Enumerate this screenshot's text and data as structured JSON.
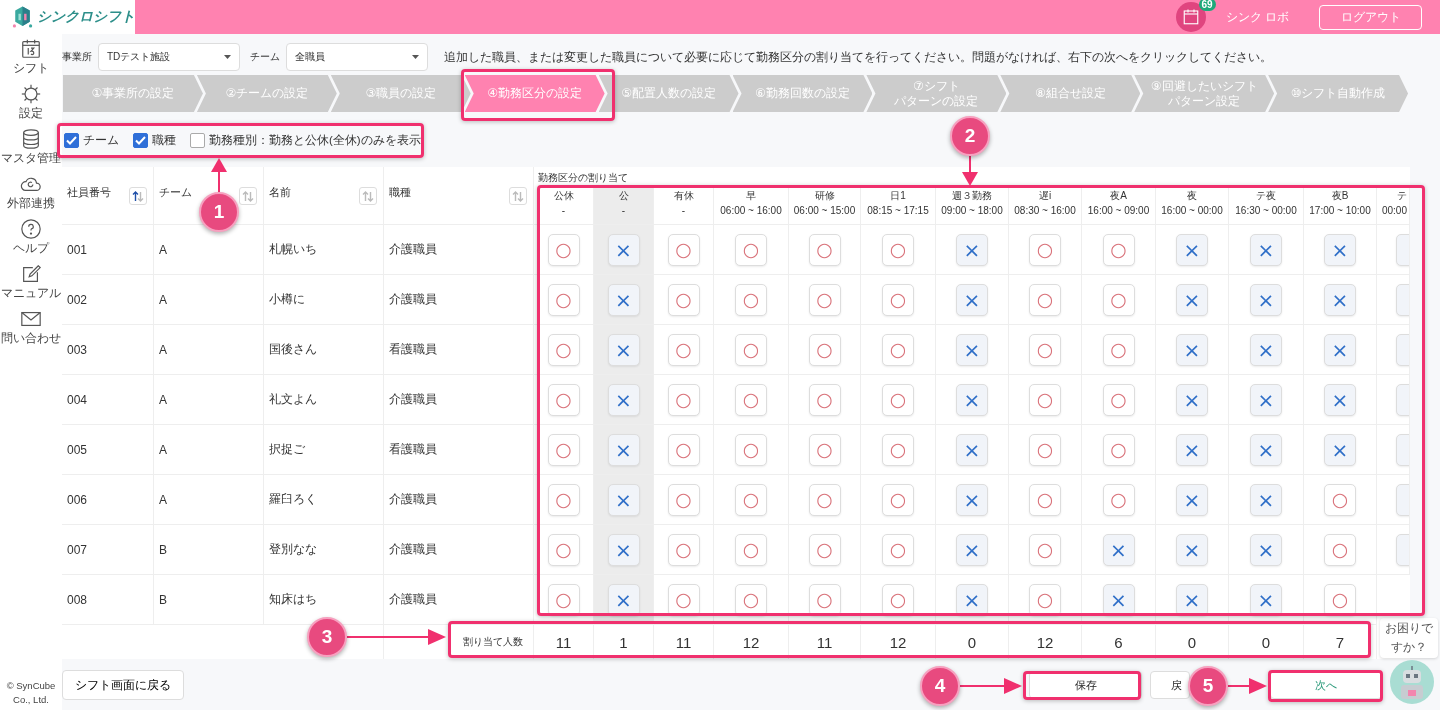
{
  "header": {
    "app_name": "シンクロシフト",
    "notification_count": "69",
    "user_name": "シンク ロボ",
    "logout_label": "ログアウト"
  },
  "sidebar": {
    "items": [
      {
        "label": "シフト",
        "kind": "calendar"
      },
      {
        "label": "設定",
        "kind": "gear"
      },
      {
        "label": "マスタ管理",
        "kind": "database"
      },
      {
        "label": "外部連携",
        "kind": "cloud"
      },
      {
        "label": "ヘルプ",
        "kind": "help"
      },
      {
        "label": "マニュアル",
        "kind": "edit"
      },
      {
        "label": "問い合わせ",
        "kind": "mail"
      }
    ],
    "copyright": [
      "© SynCube",
      "Co., Ltd."
    ]
  },
  "filters": {
    "office_label": "事業所",
    "office_value": "TDテスト施設",
    "team_label": "チーム",
    "team_value": "全職員",
    "instruction": "追加した職員、または変更した職員について必要に応じて勤務区分の割り当てを行ってください。問題がなければ、右下の次へをクリックしてください。"
  },
  "steps": [
    {
      "lines": [
        "①事業所の設定"
      ],
      "selected": false
    },
    {
      "lines": [
        "②チームの設定"
      ],
      "selected": false
    },
    {
      "lines": [
        "③職員の設定"
      ],
      "selected": false
    },
    {
      "lines": [
        "④勤務区分の設定"
      ],
      "selected": true
    },
    {
      "lines": [
        "⑤配置人数の設定"
      ],
      "selected": false
    },
    {
      "lines": [
        "⑥勤務回数の設定"
      ],
      "selected": false
    },
    {
      "lines": [
        "⑦シフト",
        "パターンの設定"
      ],
      "selected": false
    },
    {
      "lines": [
        "⑧組合せ設定"
      ],
      "selected": false
    },
    {
      "lines": [
        "⑨回避したいシフト",
        "パターン設定"
      ],
      "selected": false
    },
    {
      "lines": [
        "⑩シフト自動作成"
      ],
      "selected": false
    }
  ],
  "display_options": [
    {
      "label": "チーム",
      "checked": true
    },
    {
      "label": "職種",
      "checked": true
    },
    {
      "label": "勤務種別：勤務と公休(全休)のみを表示",
      "checked": false
    }
  ],
  "table": {
    "columns": [
      {
        "label": "社員番号",
        "sorted": true
      },
      {
        "label": "チーム",
        "sorted": false
      },
      {
        "label": "名前",
        "sorted": false
      },
      {
        "label": "職種",
        "sorted": false
      }
    ],
    "assignment_title": "勤務区分の割り当て",
    "shift_columns": [
      {
        "label": "公休",
        "time": "-",
        "highlighted": false
      },
      {
        "label": "公",
        "time": "-",
        "highlighted": true
      },
      {
        "label": "有休",
        "time": "-",
        "highlighted": false
      },
      {
        "label": "早",
        "time": "06:00 ~ 16:00",
        "highlighted": false
      },
      {
        "label": "研修",
        "time": "06:00 ~ 15:00",
        "highlighted": false
      },
      {
        "label": "日1",
        "time": "08:15 ~ 17:15",
        "highlighted": false
      },
      {
        "label": "週３勤務",
        "time": "09:00 ~ 18:00",
        "highlighted": false
      },
      {
        "label": "遅i",
        "time": "08:30 ~ 16:00",
        "highlighted": false
      },
      {
        "label": "夜A",
        "time": "16:00 ~ 09:00",
        "highlighted": false
      },
      {
        "label": "夜",
        "time": "16:00 ~ 00:00",
        "highlighted": false
      },
      {
        "label": "テ夜",
        "time": "16:30 ~ 00:00",
        "highlighted": false
      },
      {
        "label": "夜B",
        "time": "17:00 ~ 10:00",
        "highlighted": false
      },
      {
        "label": "テ",
        "time": "00:00",
        "highlighted": false
      }
    ],
    "rows": [
      {
        "id": "001",
        "team": "A",
        "name": "札幌いち",
        "job": "介護職員",
        "cells": [
          {
            "mark": "○",
            "allowed": true
          },
          {
            "mark": "×",
            "allowed": false
          },
          {
            "mark": "○",
            "allowed": true
          },
          {
            "mark": "○",
            "allowed": true
          },
          {
            "mark": "○",
            "allowed": true
          },
          {
            "mark": "○",
            "allowed": true
          },
          {
            "mark": "×",
            "allowed": false
          },
          {
            "mark": "○",
            "allowed": true
          },
          {
            "mark": "○",
            "allowed": true
          },
          {
            "mark": "×",
            "allowed": false
          },
          {
            "mark": "×",
            "allowed": false
          },
          {
            "mark": "×",
            "allowed": false
          },
          {
            "allowed": false
          }
        ]
      },
      {
        "id": "002",
        "team": "A",
        "name": "小樽に",
        "job": "介護職員",
        "cells": [
          {
            "mark": "○",
            "allowed": true
          },
          {
            "mark": "×",
            "allowed": false
          },
          {
            "mark": "○",
            "allowed": true
          },
          {
            "mark": "○",
            "allowed": true
          },
          {
            "mark": "○",
            "allowed": true
          },
          {
            "mark": "○",
            "allowed": true
          },
          {
            "mark": "×",
            "allowed": false
          },
          {
            "mark": "○",
            "allowed": true
          },
          {
            "mark": "○",
            "allowed": true
          },
          {
            "mark": "×",
            "allowed": false
          },
          {
            "mark": "×",
            "allowed": false
          },
          {
            "mark": "×",
            "allowed": false
          },
          {
            "allowed": false
          }
        ]
      },
      {
        "id": "003",
        "team": "A",
        "name": "国後さん",
        "job": "看護職員",
        "cells": [
          {
            "mark": "○",
            "allowed": true
          },
          {
            "mark": "×",
            "allowed": false
          },
          {
            "mark": "○",
            "allowed": true
          },
          {
            "mark": "○",
            "allowed": true
          },
          {
            "mark": "○",
            "allowed": true
          },
          {
            "mark": "○",
            "allowed": true
          },
          {
            "mark": "×",
            "allowed": false
          },
          {
            "mark": "○",
            "allowed": true
          },
          {
            "mark": "○",
            "allowed": true
          },
          {
            "mark": "×",
            "allowed": false
          },
          {
            "mark": "×",
            "allowed": false
          },
          {
            "mark": "×",
            "allowed": false
          },
          {
            "allowed": false
          }
        ]
      },
      {
        "id": "004",
        "team": "A",
        "name": "礼文よん",
        "job": "介護職員",
        "cells": [
          {
            "mark": "○",
            "allowed": true
          },
          {
            "mark": "×",
            "allowed": false
          },
          {
            "mark": "○",
            "allowed": true
          },
          {
            "mark": "○",
            "allowed": true
          },
          {
            "mark": "○",
            "allowed": true
          },
          {
            "mark": "○",
            "allowed": true
          },
          {
            "mark": "×",
            "allowed": false
          },
          {
            "mark": "○",
            "allowed": true
          },
          {
            "mark": "○",
            "allowed": true
          },
          {
            "mark": "×",
            "allowed": false
          },
          {
            "mark": "×",
            "allowed": false
          },
          {
            "mark": "×",
            "allowed": false
          },
          {
            "allowed": false
          }
        ]
      },
      {
        "id": "005",
        "team": "A",
        "name": "択捉ご",
        "job": "看護職員",
        "cells": [
          {
            "mark": "○",
            "allowed": true
          },
          {
            "mark": "×",
            "allowed": false
          },
          {
            "mark": "○",
            "allowed": true
          },
          {
            "mark": "○",
            "allowed": true
          },
          {
            "mark": "○",
            "allowed": true
          },
          {
            "mark": "○",
            "allowed": true
          },
          {
            "mark": "×",
            "allowed": false
          },
          {
            "mark": "○",
            "allowed": true
          },
          {
            "mark": "○",
            "allowed": true
          },
          {
            "mark": "×",
            "allowed": false
          },
          {
            "mark": "×",
            "allowed": false
          },
          {
            "mark": "×",
            "allowed": false
          },
          {
            "allowed": false
          }
        ]
      },
      {
        "id": "006",
        "team": "A",
        "name": "羅臼ろく",
        "job": "介護職員",
        "cells": [
          {
            "mark": "○",
            "allowed": true
          },
          {
            "mark": "×",
            "allowed": false
          },
          {
            "mark": "○",
            "allowed": true
          },
          {
            "mark": "○",
            "allowed": true
          },
          {
            "mark": "○",
            "allowed": true
          },
          {
            "mark": "○",
            "allowed": true
          },
          {
            "mark": "×",
            "allowed": false
          },
          {
            "mark": "○",
            "allowed": true
          },
          {
            "mark": "○",
            "allowed": true
          },
          {
            "mark": "×",
            "allowed": false
          },
          {
            "mark": "×",
            "allowed": false
          },
          {
            "mark": "○",
            "allowed": true
          },
          {
            "allowed": false
          }
        ]
      },
      {
        "id": "007",
        "team": "B",
        "name": "登別なな",
        "job": "介護職員",
        "cells": [
          {
            "mark": "○",
            "allowed": true
          },
          {
            "mark": "×",
            "allowed": false
          },
          {
            "mark": "○",
            "allowed": true
          },
          {
            "mark": "○",
            "allowed": true
          },
          {
            "mark": "○",
            "allowed": true
          },
          {
            "mark": "○",
            "allowed": true
          },
          {
            "mark": "×",
            "allowed": false
          },
          {
            "mark": "○",
            "allowed": true
          },
          {
            "mark": "×",
            "allowed": false
          },
          {
            "mark": "×",
            "allowed": false
          },
          {
            "mark": "×",
            "allowed": false
          },
          {
            "mark": "○",
            "allowed": true
          },
          {
            "allowed": false
          }
        ]
      },
      {
        "id": "008",
        "team": "B",
        "name": "知床はち",
        "job": "介護職員",
        "cells": [
          {
            "mark": "○",
            "allowed": true
          },
          {
            "mark": "×",
            "allowed": false
          },
          {
            "mark": "○",
            "allowed": true
          },
          {
            "mark": "○",
            "allowed": true
          },
          {
            "mark": "○",
            "allowed": true
          },
          {
            "mark": "○",
            "allowed": true
          },
          {
            "mark": "×",
            "allowed": false
          },
          {
            "mark": "○",
            "allowed": true
          },
          {
            "mark": "×",
            "allowed": false
          },
          {
            "mark": "×",
            "allowed": false
          },
          {
            "mark": "×",
            "allowed": false
          },
          {
            "mark": "○",
            "allowed": true
          }
        ]
      }
    ],
    "count_label": "割り当て人数",
    "counts": [
      "11",
      "1",
      "11",
      "12",
      "11",
      "12",
      "0",
      "12",
      "6",
      "0",
      "0",
      "7"
    ]
  },
  "footer": {
    "back_label": "シフト画面に戻る",
    "save_label": "保存",
    "return_label": "戻",
    "next_label": "次へ"
  },
  "help_bubble": [
    "お困りで",
    "すか？"
  ],
  "annotations": [
    {
      "number": "1"
    },
    {
      "number": "2"
    },
    {
      "number": "3"
    },
    {
      "number": "4"
    },
    {
      "number": "5"
    }
  ]
}
